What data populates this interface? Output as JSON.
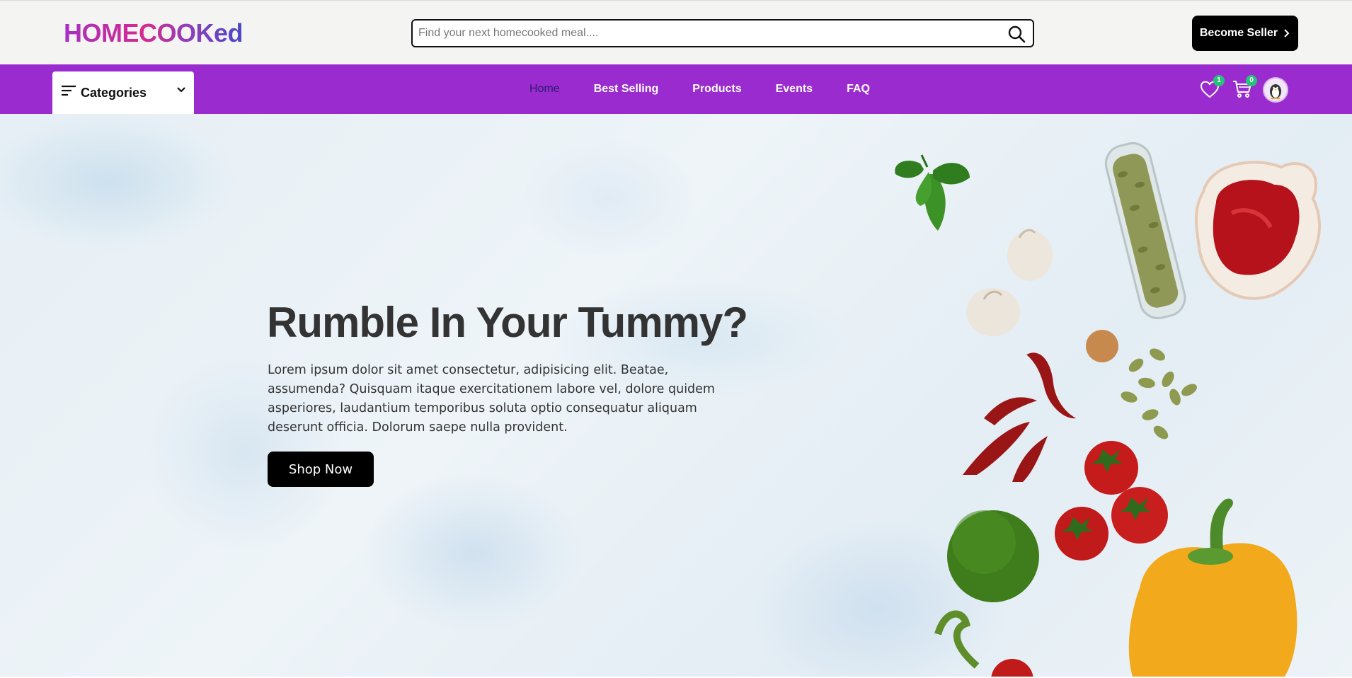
{
  "header": {
    "logo": "HOMECOOKed",
    "search": {
      "placeholder": "Find your next homecooked meal....",
      "value": ""
    },
    "seller_button": "Become Seller"
  },
  "nav": {
    "categories_label": "Categories",
    "links": [
      {
        "label": "Home",
        "active": true
      },
      {
        "label": "Best Selling",
        "active": false
      },
      {
        "label": "Products",
        "active": false
      },
      {
        "label": "Events",
        "active": false
      },
      {
        "label": "FAQ",
        "active": false
      }
    ],
    "wishlist_count": "1",
    "cart_count": "0"
  },
  "hero": {
    "title": "Rumble In Your Tummy?",
    "text": "Lorem ipsum dolor sit amet consectetur, adipisicing elit. Beatae, assumenda? Quisquam itaque exercitationem labore vel, dolore quidem asperiores, laudantium temporibus soluta optio consequatur aliquam deserunt officia. Dolorum saepe nulla provident.",
    "cta": "Shop Now"
  },
  "colors": {
    "nav_bg": "#9a2bce",
    "active_link": "#2a1a6e",
    "badge": "#27c27a",
    "button": "#000000"
  },
  "icons": [
    "search-icon",
    "chevron-right-icon",
    "menu-icon",
    "chevron-down-icon",
    "heart-icon",
    "cart-icon",
    "avatar"
  ]
}
